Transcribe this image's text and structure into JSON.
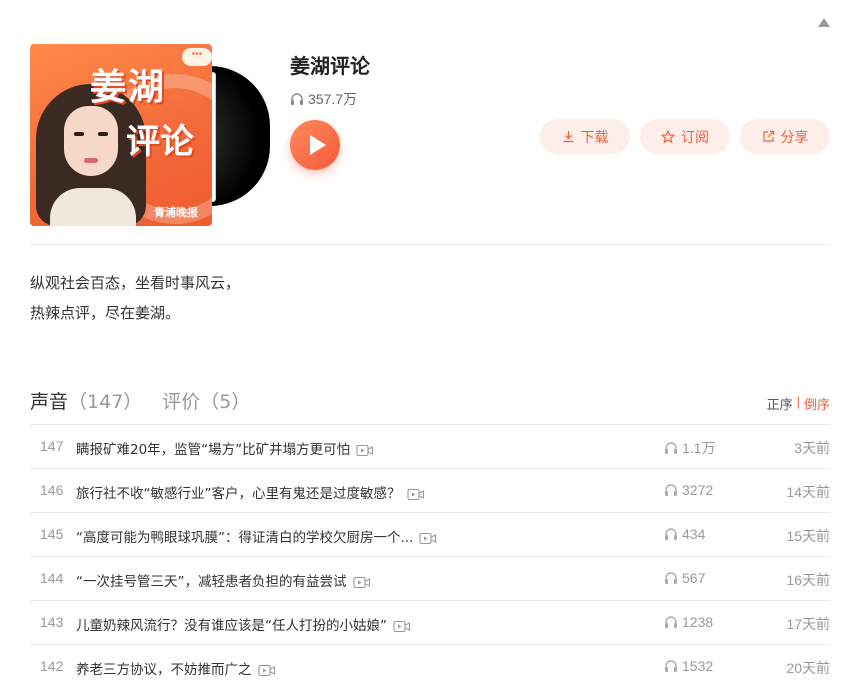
{
  "album": {
    "title": "姜湖评论",
    "play_count": "357.7万",
    "cover_title_line1": "姜湖",
    "cover_title_line2": "评论",
    "cover_logo": "青浦晚报",
    "description": [
      "纵观社会百态，坐看时事风云，",
      "热辣点评，尽在姜湖。"
    ]
  },
  "actions": {
    "download": "下载",
    "subscribe": "订阅",
    "share": "分享"
  },
  "tabs": [
    {
      "label": "声音",
      "count": "（147）"
    },
    {
      "label": "评价",
      "count": "（5）"
    }
  ],
  "sort": {
    "asc": "正序",
    "separator": "|",
    "desc": "倒序",
    "selected": "倒序"
  },
  "tracks": [
    {
      "index": "147",
      "title": "瞒报矿难20年，监管“場方”比矿井塌方更可怕",
      "plays": "1.1万",
      "date": "3天前"
    },
    {
      "index": "146",
      "title": "旅行社不收“敏感行业”客户，心里有鬼还是过度敏感？",
      "plays": "3272",
      "date": "14天前"
    },
    {
      "index": "145",
      "title": "“高度可能为鸭眼球巩膜”：得证清白的学校欠厨房一个...",
      "plays": "434",
      "date": "15天前"
    },
    {
      "index": "144",
      "title": "“一次挂号管三天”，减轻患者负担的有益尝试",
      "plays": "567",
      "date": "16天前"
    },
    {
      "index": "143",
      "title": "儿童奶辣风流行？没有谁应该是“任人打扮的小姑娘”",
      "plays": "1238",
      "date": "17天前"
    },
    {
      "index": "142",
      "title": "养老三方协议，不妨推而广之",
      "plays": "1532",
      "date": "20天前"
    }
  ],
  "colors": {
    "accent": "#f3613b",
    "accent_bg": "#fdeeea"
  },
  "icons": {
    "collapse": "triangle-up-icon",
    "headphones": "headphones-icon",
    "play": "play-icon",
    "download": "download-icon",
    "subscribe": "star-icon",
    "share": "share-icon",
    "video": "video-icon"
  }
}
